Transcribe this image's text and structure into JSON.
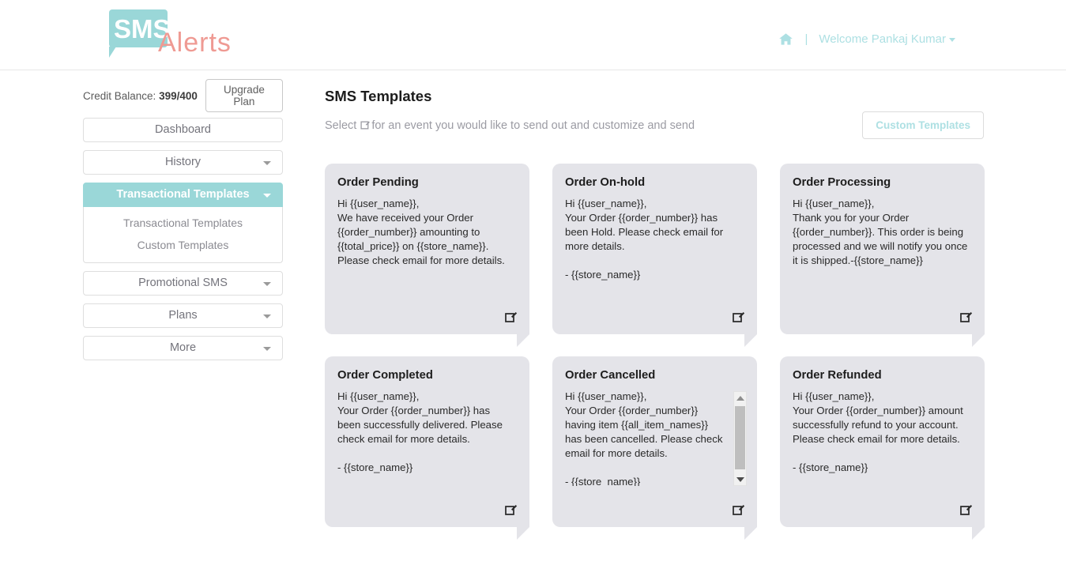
{
  "header": {
    "logo_primary": "SMS",
    "logo_secondary": "Alerts",
    "home_icon": "home-icon",
    "separator": "|",
    "welcome_text": "Welcome Pankaj Kumar",
    "accent_color": "#9ad7d8",
    "logo_secondary_color": "#ef9a93",
    "header_link_color": "#ade0e3"
  },
  "sidebar": {
    "credit_label": "Credit Balance:",
    "credit_value": "399/400",
    "upgrade_label": "Upgrade Plan",
    "items": [
      {
        "label": "Dashboard",
        "has_caret": false,
        "active": false
      },
      {
        "label": "History",
        "has_caret": true,
        "active": false
      },
      {
        "label": "Transactional Templates",
        "has_caret": true,
        "active": true
      },
      {
        "label": "Promotional SMS",
        "has_caret": true,
        "active": false
      },
      {
        "label": "Plans",
        "has_caret": true,
        "active": false
      },
      {
        "label": "More",
        "has_caret": true,
        "active": false
      }
    ],
    "submenu": [
      {
        "label": "Transactional Templates"
      },
      {
        "label": "Custom Templates"
      }
    ]
  },
  "main": {
    "title": "SMS Templates",
    "subtitle_before": "Select ",
    "subtitle_icon": "edit-icon",
    "subtitle_after": "for an event you would like to send out and customize and send",
    "custom_templates_button": "Custom Templates"
  },
  "cards": [
    {
      "title": "Order Pending",
      "body": "Hi {{user_name}},\nWe have received your Order {{order_number}} amounting to {{total_price}} on {{store_name}}. Please check email for more details.",
      "edit_icon": "edit-icon",
      "scrollbar": false
    },
    {
      "title": "Order On-hold",
      "body": "Hi {{user_name}},\nYour Order {{order_number}} has been Hold. Please check email for more details.\n\n- {{store_name}}",
      "edit_icon": "edit-icon",
      "scrollbar": false
    },
    {
      "title": "Order Processing",
      "body": "Hi {{user_name}},\nThank you for your Order {{order_number}}. This order is being processed and we will notify you once it is shipped.-{{store_name}}",
      "edit_icon": "edit-icon",
      "scrollbar": false
    },
    {
      "title": "Order Completed",
      "body": "Hi {{user_name}},\nYour Order {{order_number}} has been successfully delivered. Please check email for more details.\n\n- {{store_name}}",
      "edit_icon": "edit-icon",
      "scrollbar": false
    },
    {
      "title": "Order Cancelled",
      "body": "Hi {{user_name}},\nYour Order {{order_number}} having item {{all_item_names}} has been cancelled. Please check email for more details.\n\n- {{store_name}}",
      "edit_icon": "edit-icon",
      "scrollbar": true
    },
    {
      "title": "Order Refunded",
      "body": "Hi {{user_name}},\nYour Order {{order_number}} amount successfully refund to your account. Please check email for more details.\n\n- {{store_name}}",
      "edit_icon": "edit-icon",
      "scrollbar": false
    }
  ]
}
